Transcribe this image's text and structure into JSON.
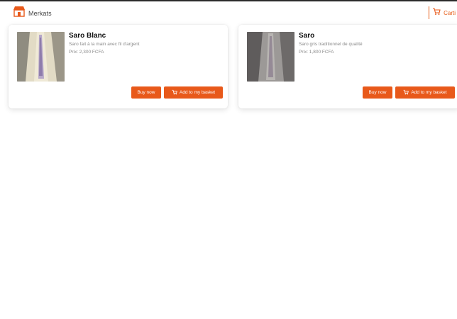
{
  "header": {
    "brand_label": "Merkats",
    "brand_icon": "store-icon",
    "cart_label": "Carti",
    "cart_icon": "cart-icon"
  },
  "colors": {
    "accent": "#e8591a",
    "text_dark": "#111111",
    "text_muted": "#8a8a8a"
  },
  "products": [
    {
      "name": "Saro Blanc",
      "description": "Saro fait à la main avec fil d'argent",
      "price": "Prix: 2,300 FCFA",
      "buy_label": "Buy now",
      "add_label": "Add to my basket"
    },
    {
      "name": "Saro",
      "description": "Saro gris traditionnel de qualité",
      "price": "Prix: 1,800 FCFA",
      "buy_label": "Buy now",
      "add_label": "Add to my basket"
    }
  ]
}
